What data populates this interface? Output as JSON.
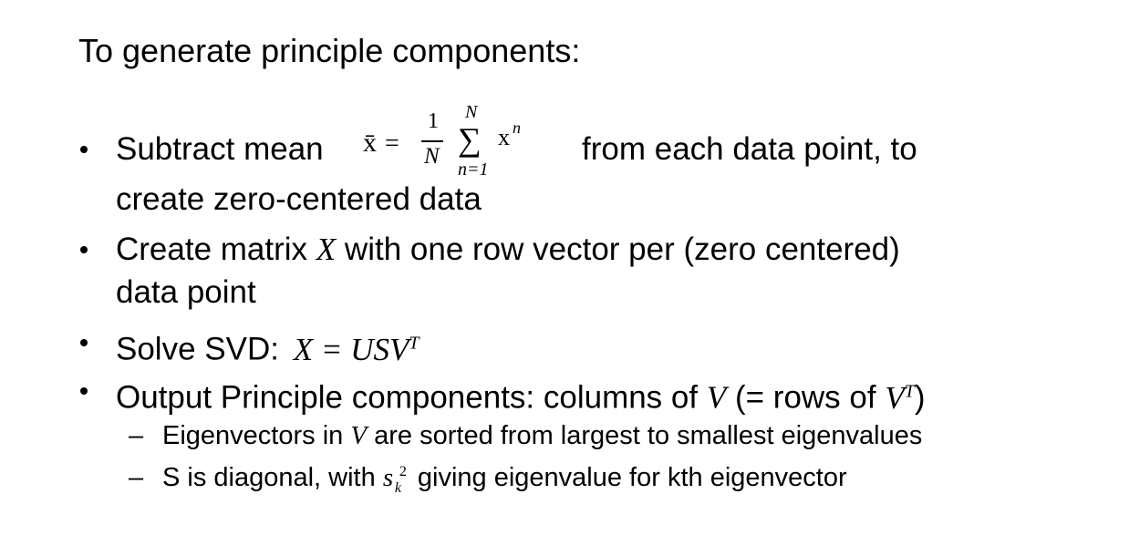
{
  "heading": "To generate principle components:",
  "bullets": {
    "b1": {
      "text_before": "Subtract mean",
      "text_after": "from each data point, to",
      "line2": "create zero-centered data"
    },
    "formula": {
      "xbar": "x̄",
      "equals": "=",
      "numerator": "1",
      "denominator": "N",
      "upper_limit": "N",
      "sigma": "∑",
      "term_base": "x",
      "term_exp": "n",
      "lower_limit": "n=1"
    },
    "b2": {
      "text_a": "Create matrix",
      "var": "X",
      "text_b": "with one row vector per (zero centered)",
      "line2": "data point"
    },
    "b3": {
      "text": "Solve SVD:",
      "equation": "X = USV",
      "sup": "T"
    },
    "b4": {
      "text_a": "Output Principle components: columns of",
      "var": "V",
      "text_b": "(= rows of",
      "var2": "V",
      "sup": "T",
      "text_c": ")"
    }
  },
  "subbullets": {
    "dash": "–",
    "s1": {
      "text_a": "Eigenvectors in",
      "var": "V",
      "text_b": "are sorted from largest to smallest eigenvalues"
    },
    "s2": {
      "text_a": "S is diagonal, with",
      "var": "s",
      "sub": "k",
      "sup": "2",
      "text_b": "giving eigenvalue for kth eigenvector"
    }
  }
}
